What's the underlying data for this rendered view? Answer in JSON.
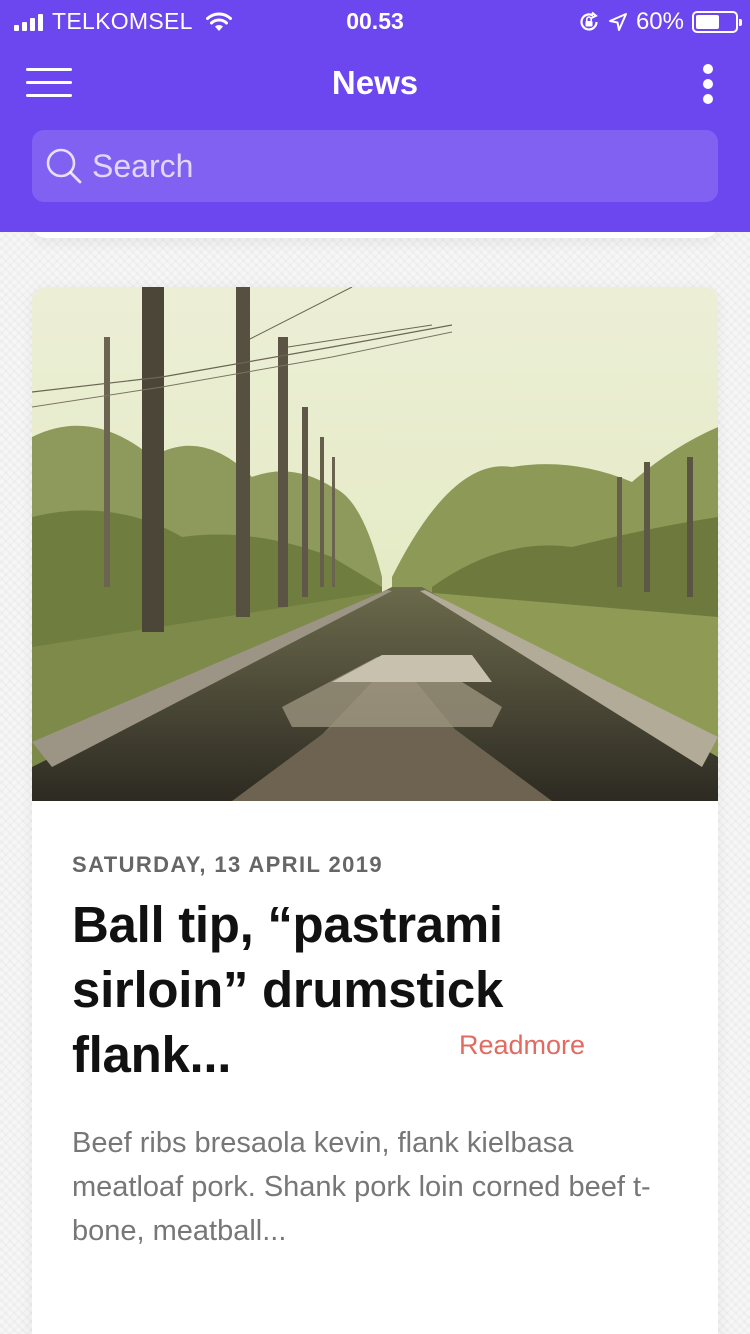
{
  "status_bar": {
    "carrier": "TELKOMSEL",
    "time": "00.53",
    "battery_text": "60%",
    "battery_level": 0.6,
    "icons": [
      "signal-icon",
      "wifi-icon",
      "orientation-lock-icon",
      "location-icon",
      "battery-icon"
    ]
  },
  "navbar": {
    "title": "News",
    "menu_icon": "hamburger-menu-icon",
    "more_icon": "more-vertical-icon"
  },
  "search": {
    "placeholder": "Search",
    "value": ""
  },
  "article": {
    "image": "railway-tracks-photo",
    "date": "SATURDAY, 13 APRIL 2019",
    "title": "Ball tip, “pastrami sirloin” drumstick flank...",
    "excerpt": "Beef ribs bresaola kevin, flank kielbasa meatloaf pork. Shank pork loin corned beef t-bone, meatball...",
    "readmore": "Readmore"
  },
  "colors": {
    "header": "#6c47f0",
    "accent": "#e26a5f"
  }
}
